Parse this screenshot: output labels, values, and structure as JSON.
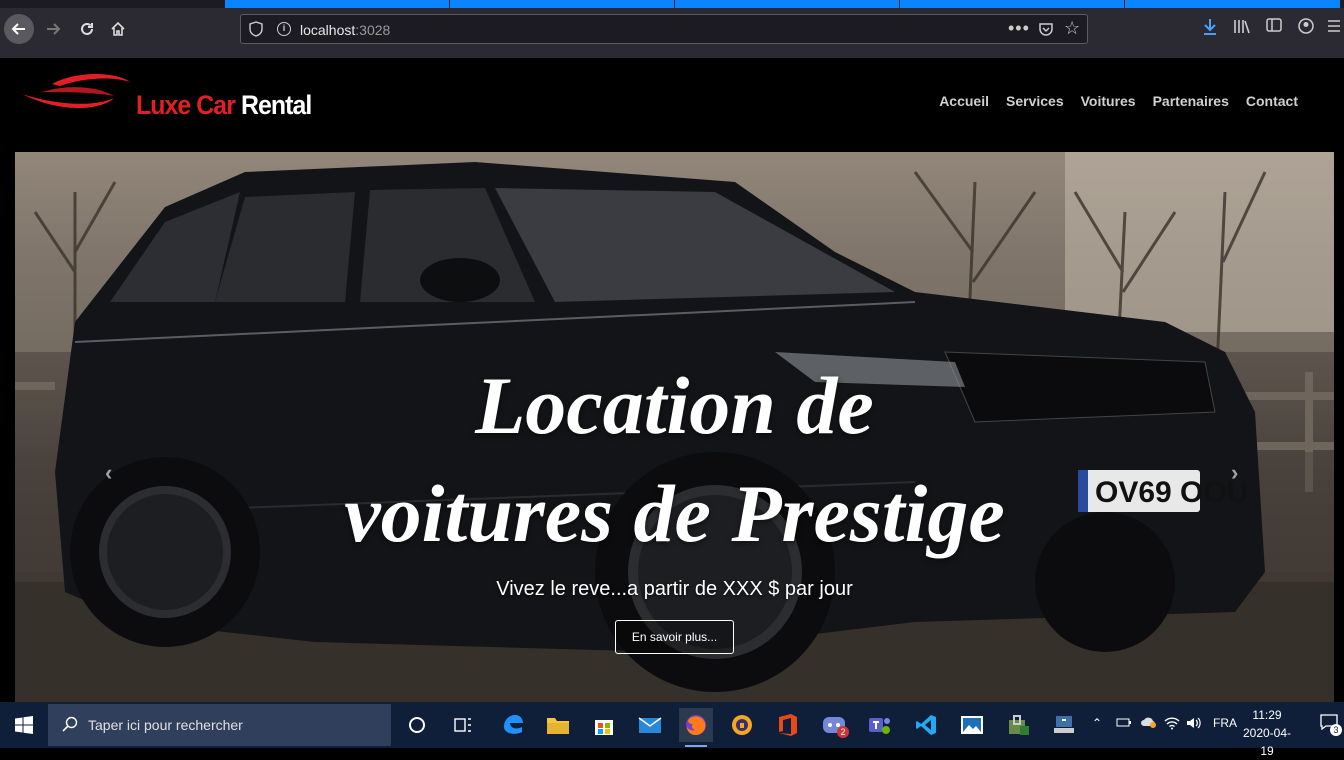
{
  "browser": {
    "url_host": "localhost",
    "url_port": ":3028"
  },
  "site": {
    "brand_red": "Luxe Car",
    "brand_white": "Rental",
    "nav": [
      "Accueil",
      "Services",
      "Voitures",
      "Partenaires",
      "Contact"
    ],
    "hero": {
      "title_line1": "Location de",
      "title_line2": "voitures de Prestige",
      "subtitle": "Vivez le reve...a partir de XXX $ par jour",
      "button": "En savoir plus...",
      "plate": "OV69 OOU"
    },
    "colors": {
      "brand_red": "#e31e24",
      "background": "#000000"
    }
  },
  "taskbar": {
    "search_placeholder": "Taper ici pour rechercher",
    "language": "FRA",
    "time": "11:29",
    "date": "2020-04-19",
    "teams_badge": "2",
    "notification_count": "3"
  }
}
